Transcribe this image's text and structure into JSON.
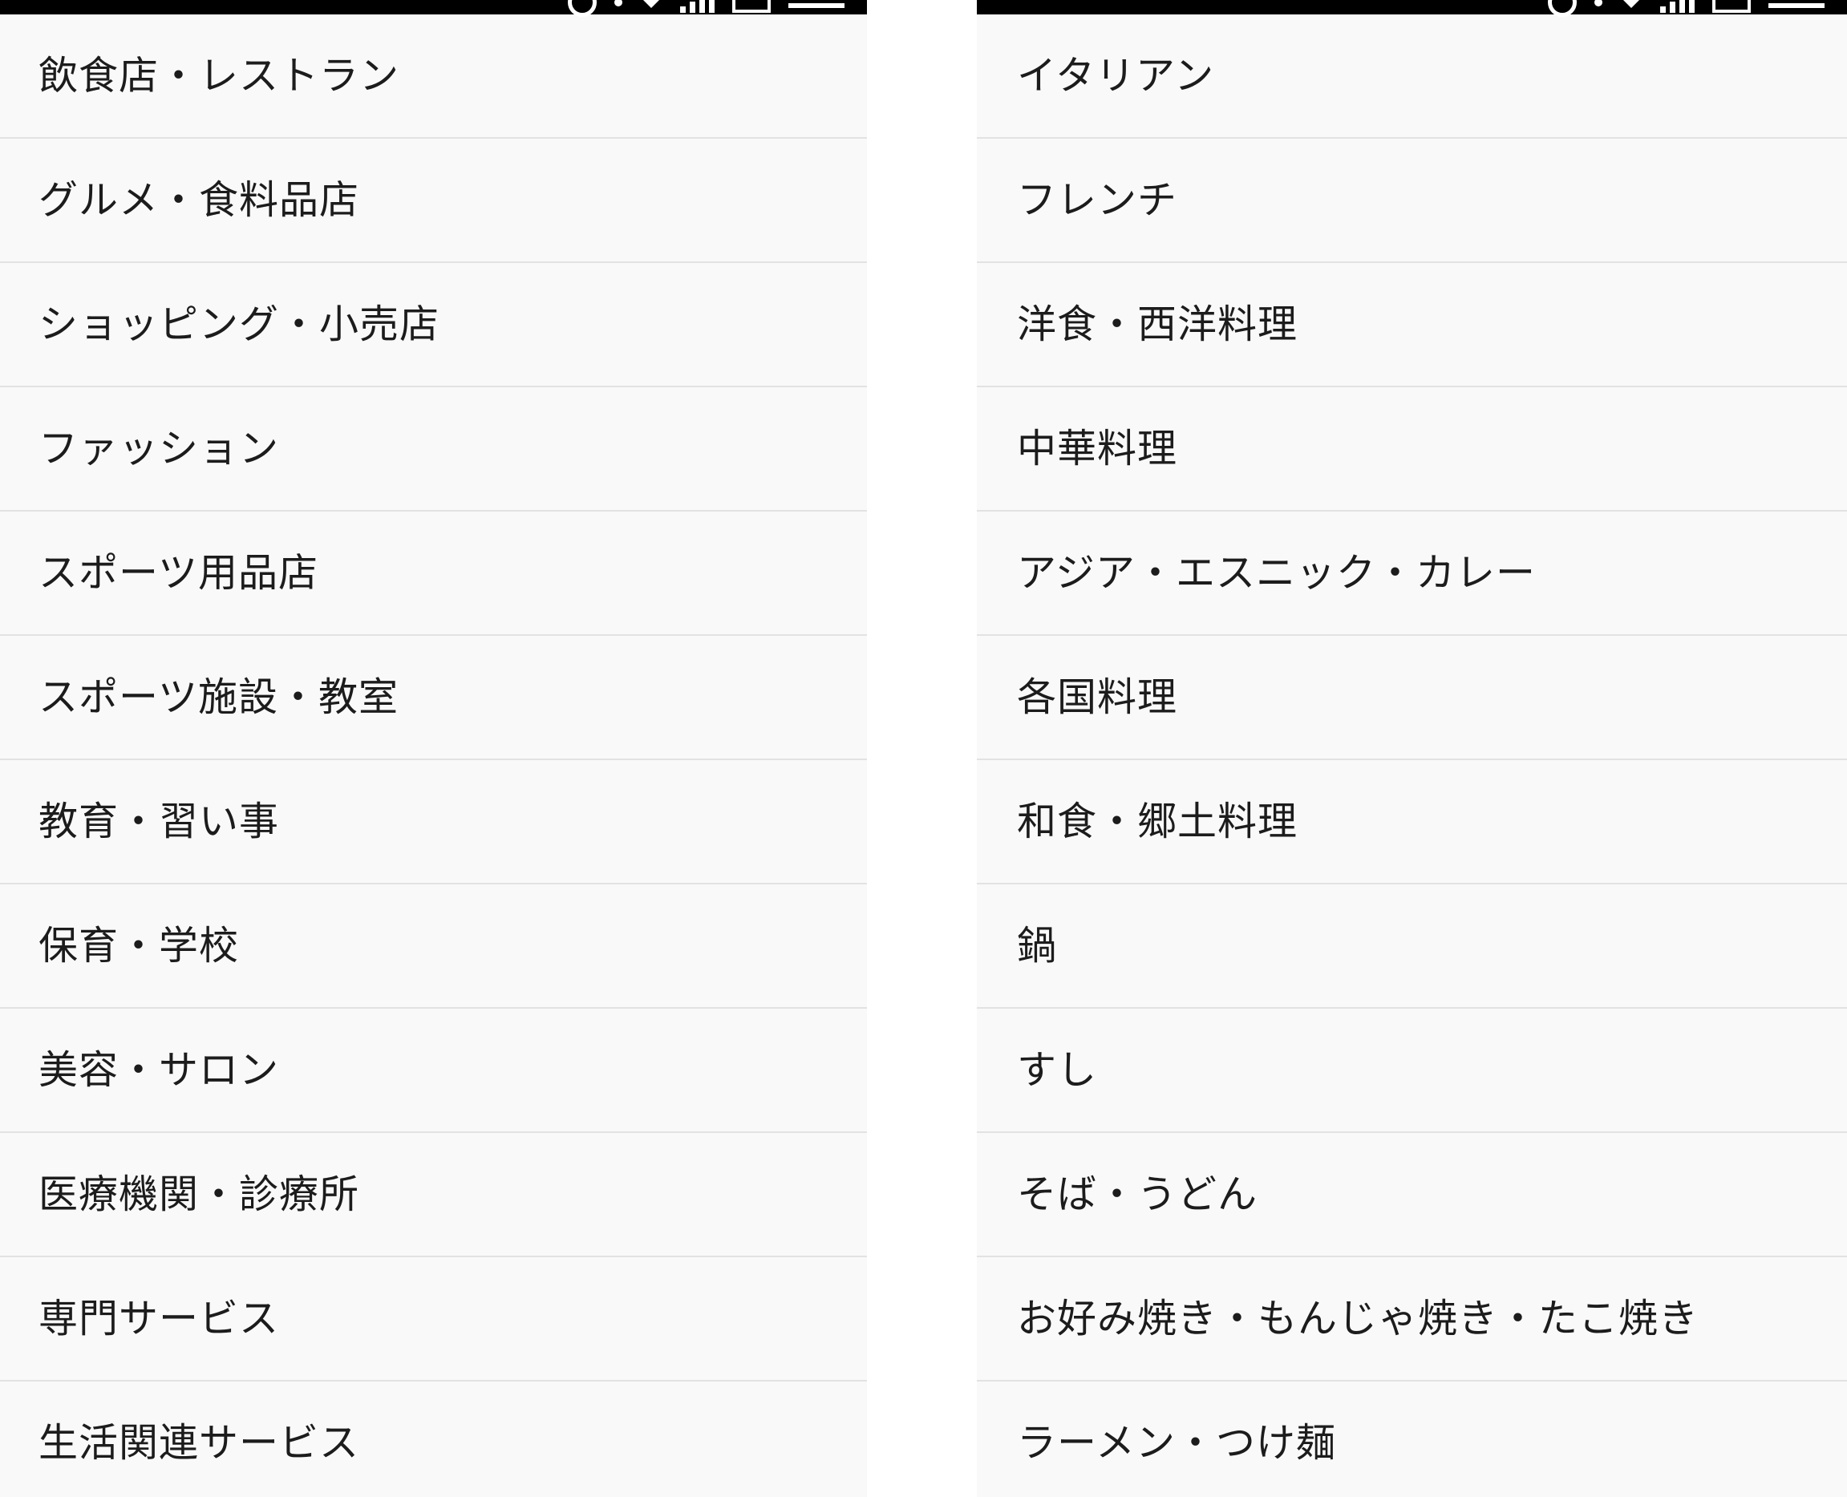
{
  "left_list": {
    "items": [
      {
        "label": "飲食店・レストラン"
      },
      {
        "label": "グルメ・食料品店"
      },
      {
        "label": "ショッピング・小売店"
      },
      {
        "label": "ファッション"
      },
      {
        "label": "スポーツ用品店"
      },
      {
        "label": "スポーツ施設・教室"
      },
      {
        "label": "教育・習い事"
      },
      {
        "label": "保育・学校"
      },
      {
        "label": "美容・サロン"
      },
      {
        "label": "医療機関・診療所"
      },
      {
        "label": "専門サービス"
      },
      {
        "label": "生活関連サービス"
      }
    ]
  },
  "right_list": {
    "items": [
      {
        "label": "イタリアン"
      },
      {
        "label": "フレンチ"
      },
      {
        "label": "洋食・西洋料理"
      },
      {
        "label": "中華料理"
      },
      {
        "label": "アジア・エスニック・カレー"
      },
      {
        "label": "各国料理"
      },
      {
        "label": "和食・郷土料理"
      },
      {
        "label": "鍋"
      },
      {
        "label": "すし"
      },
      {
        "label": "そば・うどん"
      },
      {
        "label": "お好み焼き・もんじゃ焼き・たこ焼き"
      },
      {
        "label": "ラーメン・つけ麺"
      }
    ]
  },
  "status_bar": {
    "icons": [
      "sync-icon",
      "dot-icon",
      "wifi-icon",
      "signal-icon",
      "battery-icon",
      "clock-text"
    ]
  },
  "colors": {
    "background": "#f9f9f9",
    "divider": "#e2e2e2",
    "text": "#1c1c1c",
    "status_bar": "#000000"
  }
}
